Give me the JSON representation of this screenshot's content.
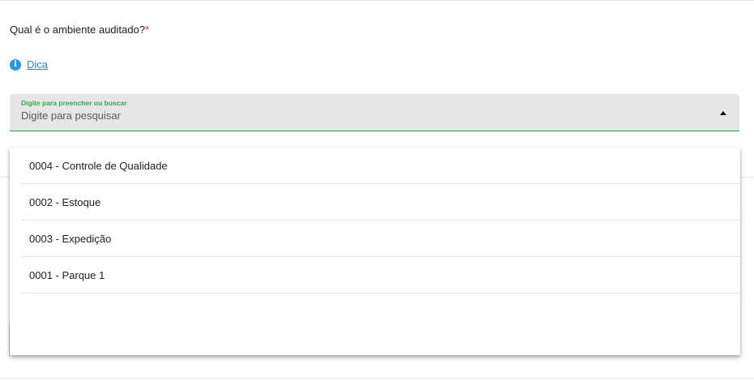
{
  "question": {
    "text": "Qual é o ambiente auditado?",
    "required_mark": "*"
  },
  "hint": {
    "icon": "info-icon",
    "label": "Dica"
  },
  "search_field": {
    "label": "Digite para preencher ou buscar",
    "placeholder": "Digite para pesquisar",
    "value": ""
  },
  "dropdown": {
    "options": [
      "0004 - Controle de Qualidade",
      "0002 - Estoque",
      "0003 - Expedição",
      "0001 - Parque 1"
    ]
  },
  "colors": {
    "accent_green": "#2eaa52",
    "link_blue": "#1e88e5",
    "required_red": "#d32f2f",
    "field_bg": "#e6e6e6"
  }
}
